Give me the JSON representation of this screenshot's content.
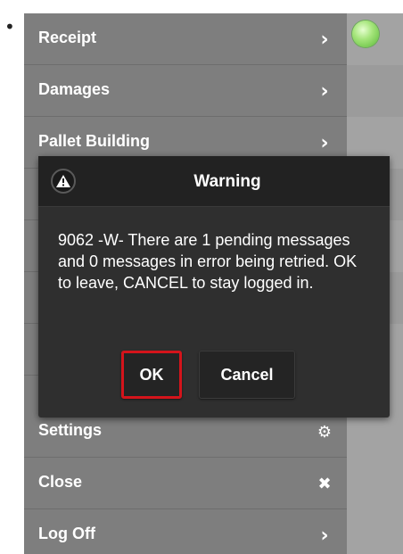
{
  "menu": {
    "items": [
      {
        "label": "Receipt",
        "icon": "chevron-right-icon",
        "glyph": "›"
      },
      {
        "label": "Damages",
        "icon": "chevron-right-icon",
        "glyph": "›"
      },
      {
        "label": "Pallet Building",
        "icon": "chevron-right-icon",
        "glyph": "›"
      }
    ],
    "bottom_items": [
      {
        "label": "Settings",
        "icon": "gear-icon",
        "glyph": "⚙"
      },
      {
        "label": "Close",
        "icon": "close-icon",
        "glyph": "✖"
      },
      {
        "label": "Log Off",
        "icon": "chevron-right-icon",
        "glyph": "›"
      }
    ]
  },
  "status": {
    "color": "#6cc845"
  },
  "dialog": {
    "title": "Warning",
    "icon": "warning-icon",
    "message": "9062 -W- There are 1 pending messages and 0 messages in error being retried. OK to leave, CANCEL to stay logged in.",
    "ok_label": "OK",
    "cancel_label": "Cancel",
    "highlight_color": "#d4141b"
  }
}
